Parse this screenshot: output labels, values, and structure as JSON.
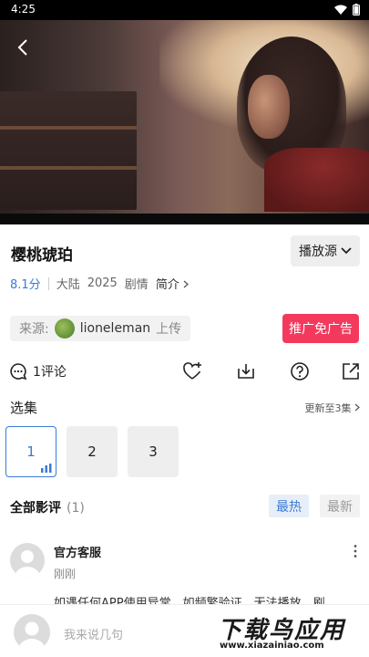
{
  "status_bar": {
    "time": "4:25"
  },
  "movie": {
    "title": "樱桃琥珀",
    "source_button_label": "播放源",
    "score": "8.1分",
    "region": "大陆",
    "year": "2025",
    "genre": "剧情",
    "intro_label": "简介"
  },
  "uploader": {
    "prefix": "来源:",
    "name": "lioneleman",
    "suffix": "上传"
  },
  "promo_button_label": "推广免广告",
  "actions": {
    "comment_count_label": "1评论",
    "icons": [
      "favorite-add-icon",
      "download-icon",
      "help-icon",
      "share-icon"
    ]
  },
  "episodes": {
    "title": "选集",
    "more_label": "更新至3集",
    "items": [
      "1",
      "2",
      "3"
    ],
    "active_index": 0
  },
  "reviews": {
    "title": "全部影评",
    "count": "(1)",
    "sort_hot": "最热",
    "sort_new": "最新",
    "items": [
      {
        "user": "官方客服",
        "time": "刚刚",
        "text": "如遇任何APP使用异常，如频繁验证，无法播放，刷"
      }
    ]
  },
  "bottom_input": {
    "placeholder": "我来说几句"
  },
  "watermark": {
    "top": "下载鸟应用",
    "bottom": "www.xiazainiao.com"
  },
  "colors": {
    "accent": "#3a7bd5",
    "promo": "#f33a5e"
  }
}
